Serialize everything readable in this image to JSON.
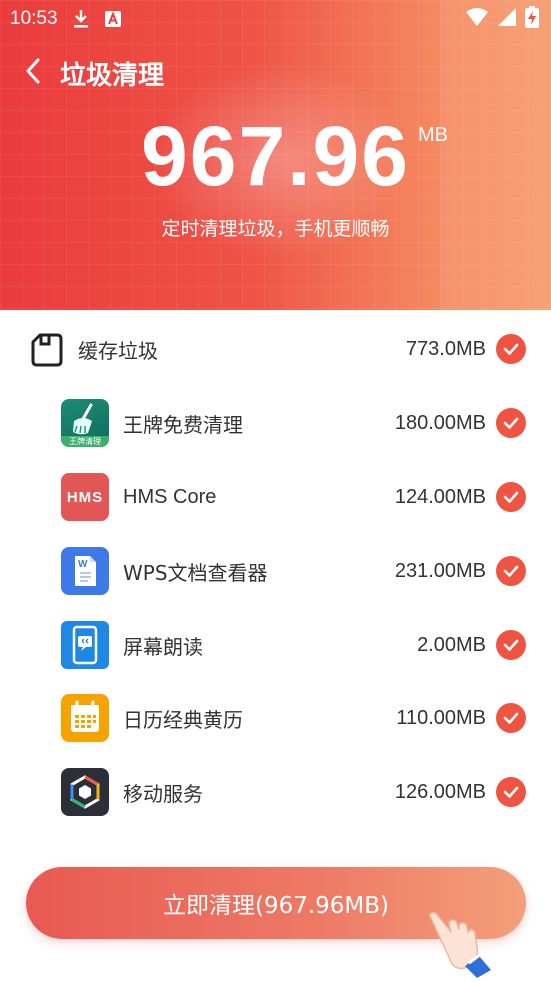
{
  "status_bar": {
    "time": "10:53",
    "icons": [
      "download-icon",
      "app-notification-icon",
      "wifi-icon",
      "signal-icon",
      "battery-charging-icon"
    ]
  },
  "header": {
    "title": "垃圾清理",
    "back_icon": "chevron-left-icon"
  },
  "summary": {
    "total_value": "967.96",
    "total_unit": "MB",
    "subtitle": "定时清理垃圾，手机更顺畅"
  },
  "category": {
    "icon": "sd-card-icon",
    "label": "缓存垃圾",
    "size": "773.0MB",
    "checked": true
  },
  "apps": [
    {
      "name": "王牌免费清理",
      "size": "180.00MB",
      "icon": "broom-cleaner-icon",
      "icon_text": "王牌清理",
      "checked": true
    },
    {
      "name": "HMS Core",
      "size": "124.00MB",
      "icon": "hms-icon",
      "icon_text": "HMS",
      "checked": true
    },
    {
      "name": "WPS文档查看器",
      "size": "231.00MB",
      "icon": "wps-document-icon",
      "icon_text": "W",
      "checked": true
    },
    {
      "name": "屏幕朗读",
      "size": "2.00MB",
      "icon": "screen-reader-icon",
      "checked": true
    },
    {
      "name": "日历经典黄历",
      "size": "110.00MB",
      "icon": "calendar-icon",
      "checked": true
    },
    {
      "name": "移动服务",
      "size": "126.00MB",
      "icon": "mobile-services-icon",
      "checked": true
    }
  ],
  "action": {
    "button_label": "立即清理(967.96MB)",
    "pointer_icon": "hand-pointer-icon"
  },
  "colors": {
    "accent": "#ef5443",
    "hero_start": "#ea3c3d",
    "hero_end": "#f69a6c"
  }
}
